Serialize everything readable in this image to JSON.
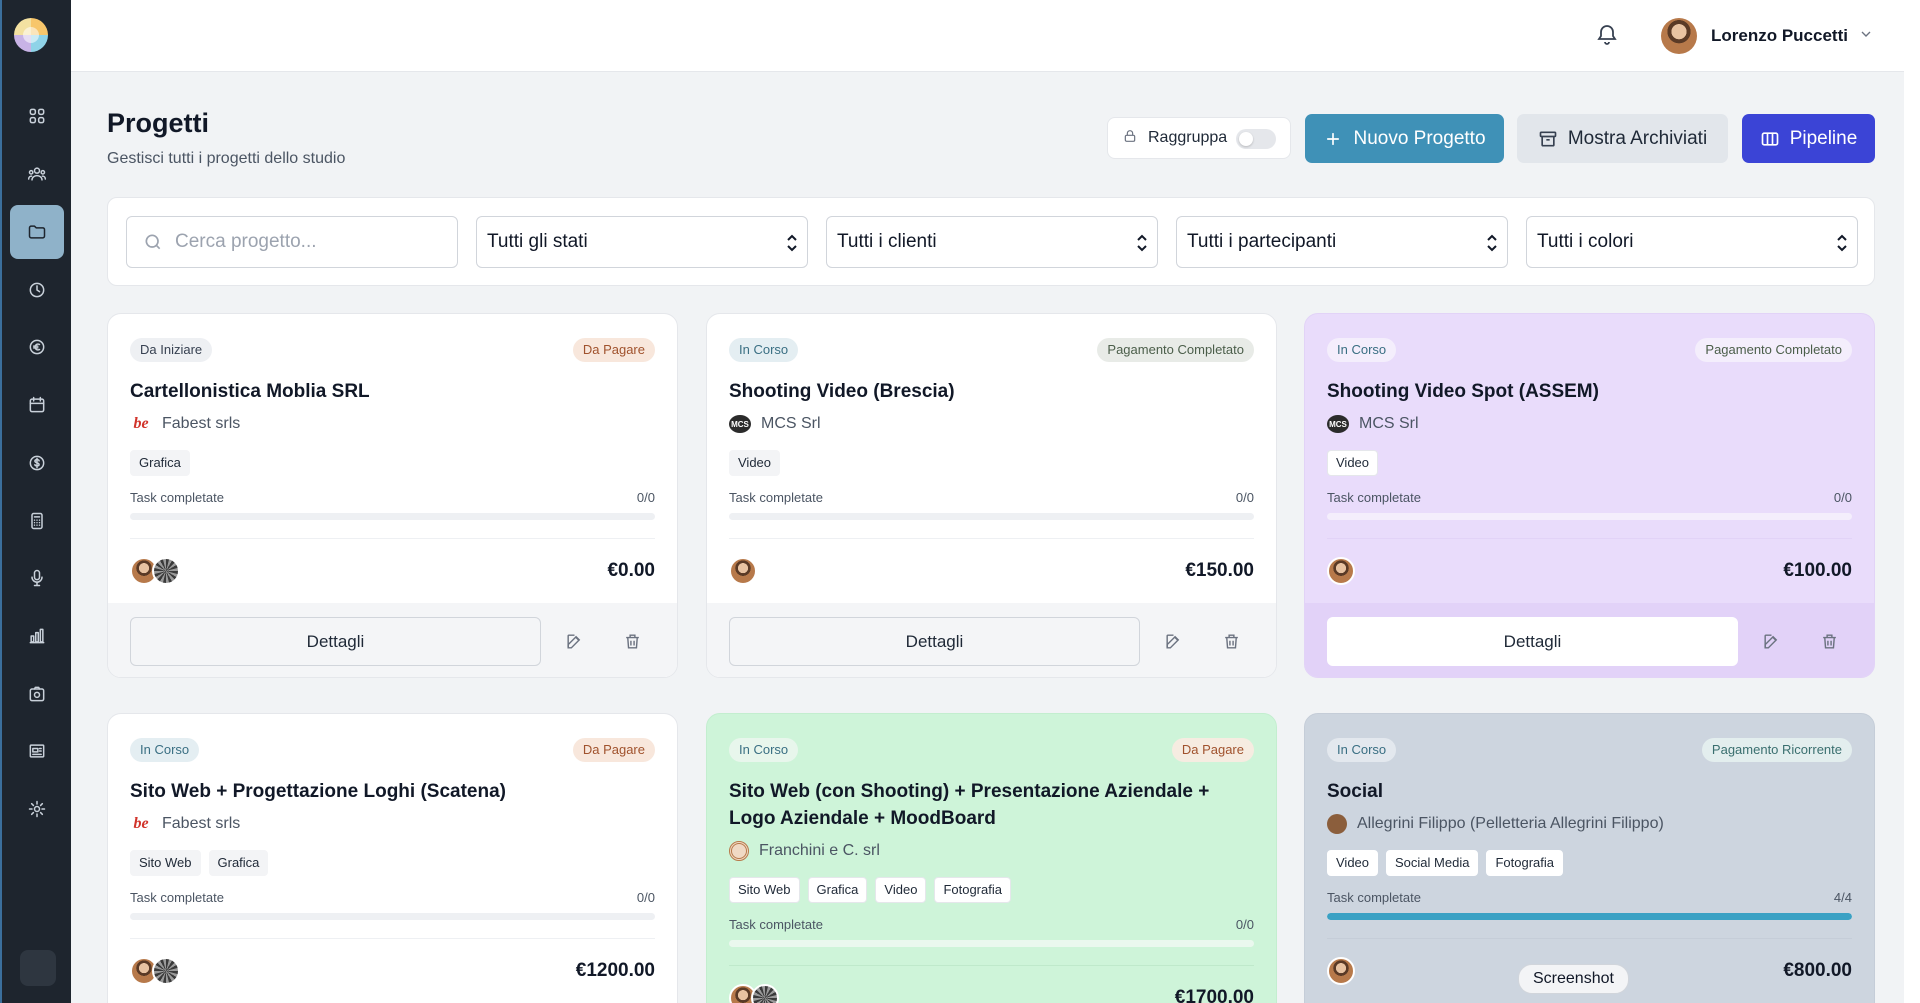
{
  "header": {
    "user_name": "Lorenzo Puccetti"
  },
  "page": {
    "title": "Progetti",
    "subtitle": "Gestisci tutti i progetti dello studio"
  },
  "toolbar": {
    "group_label": "Raggruppa",
    "group_enabled": false,
    "new_label": "Nuovo Progetto",
    "archive_label": "Mostra Archiviati",
    "pipeline_label": "Pipeline"
  },
  "filters": {
    "search_placeholder": "Cerca progetto...",
    "status": "Tutti gli stati",
    "clients": "Tutti i clienti",
    "participants": "Tutti i partecipanti",
    "colors": "Tutti i colori"
  },
  "sidebar": {
    "items": [
      "dashboard-icon",
      "users-icon",
      "folder-icon",
      "clock-icon",
      "euro-icon",
      "calendar-icon",
      "dollar-icon",
      "calculator-icon",
      "microphone-icon",
      "bar-chart-icon",
      "camera-icon",
      "newspaper-icon",
      "gear-icon"
    ],
    "active": "folder-icon"
  },
  "projects": [
    {
      "status": "Da Iniziare",
      "payment": "Da Pagare",
      "title": "Cartellonistica Moblia SRL",
      "client": "Fabest srls",
      "tags": [
        "Grafica"
      ],
      "tasks_label": "Task completate",
      "tasks": "0/0",
      "progress": 0,
      "price": "€0.00",
      "details_label": "Dettagli",
      "color": "#ffffff"
    },
    {
      "status": "In Corso",
      "payment": "Pagamento Completato",
      "title": "Shooting Video (Brescia)",
      "client": "MCS Srl",
      "tags": [
        "Video"
      ],
      "tasks_label": "Task completate",
      "tasks": "0/0",
      "progress": 0,
      "price": "€150.00",
      "details_label": "Dettagli",
      "color": "#ffffff"
    },
    {
      "status": "In Corso",
      "payment": "Pagamento Completato",
      "title": "Shooting Video Spot (ASSEM)",
      "client": "MCS Srl",
      "tags": [
        "Video"
      ],
      "tasks_label": "Task completate",
      "tasks": "0/0",
      "progress": 0,
      "price": "€100.00",
      "details_label": "Dettagli",
      "color": "#e9dcfb"
    },
    {
      "status": "In Corso",
      "payment": "Da Pagare",
      "title": "Sito Web + Progettazione Loghi (Scatena)",
      "client": "Fabest srls",
      "tags": [
        "Sito Web",
        "Grafica"
      ],
      "tasks_label": "Task completate",
      "tasks": "0/0",
      "progress": 0,
      "price": "€1200.00",
      "color": "#ffffff"
    },
    {
      "status": "In Corso",
      "payment": "Da Pagare",
      "title": "Sito Web (con Shooting) + Presentazione Aziendale + Logo Aziendale + MoodBoard",
      "client": "Franchini e C. srl",
      "tags": [
        "Sito Web",
        "Grafica",
        "Video",
        "Fotografia"
      ],
      "tasks_label": "Task completate",
      "tasks": "0/0",
      "progress": 0,
      "price": "€1700.00",
      "color": "#cef4d9"
    },
    {
      "status": "In Corso",
      "payment": "Pagamento Ricorrente",
      "title": "Social",
      "client": "Allegrini Filippo (Pelletteria Allegrini Filippo)",
      "tags": [
        "Video",
        "Social Media",
        "Fotografia"
      ],
      "tasks_label": "Task completate",
      "tasks": "4/4",
      "progress": 1.0,
      "price": "€800.00",
      "color": "#cdd5df"
    }
  ],
  "tooltip": "Screenshot"
}
